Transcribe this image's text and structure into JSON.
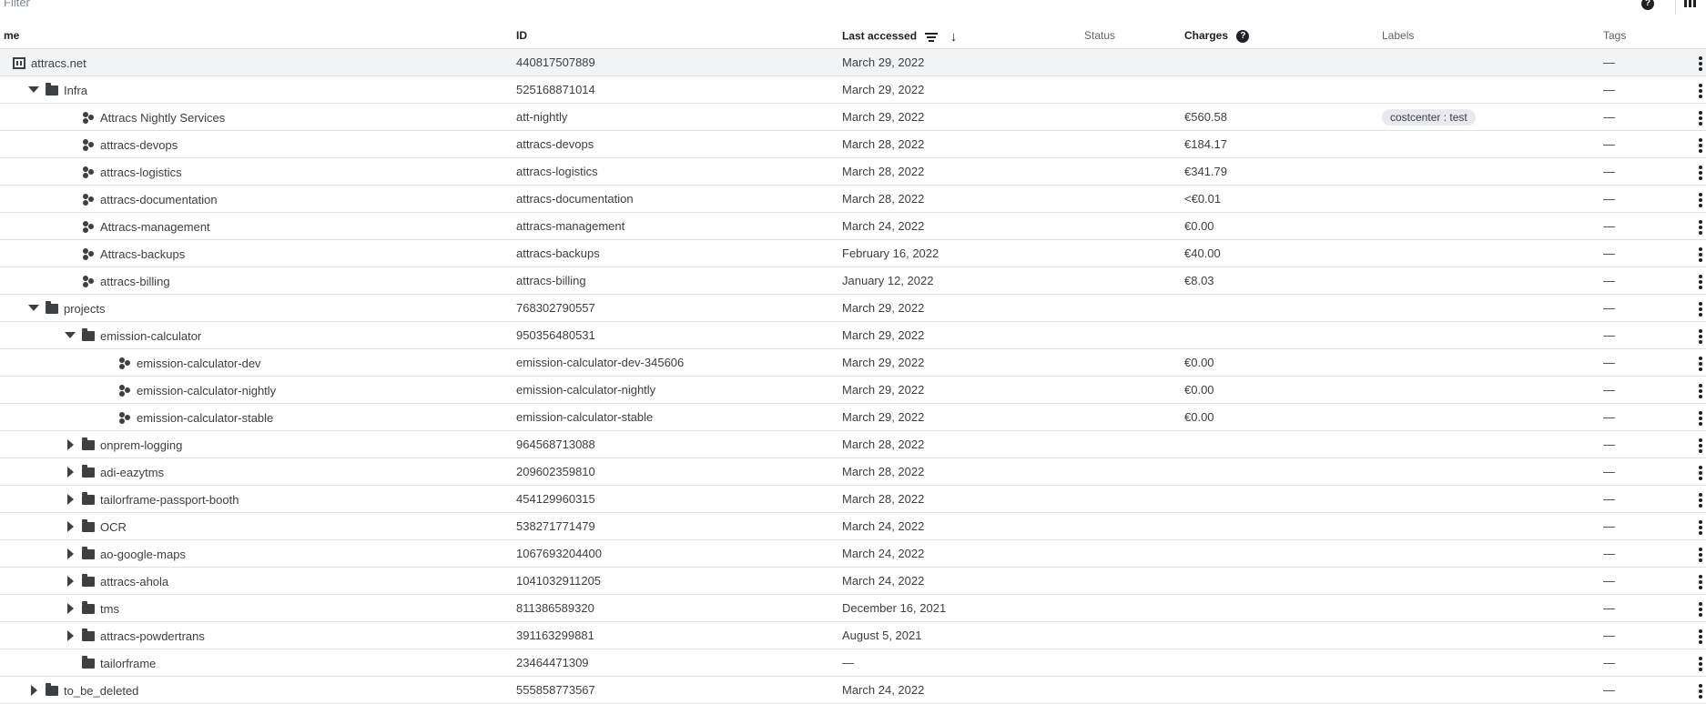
{
  "filter": {
    "placeholder": "Filter",
    "help_icon": "?"
  },
  "columns": {
    "name": "me",
    "id": "ID",
    "last_accessed": "Last accessed",
    "status": "Status",
    "charges": "Charges",
    "charges_help": "?",
    "labels": "Labels",
    "tags": "Tags",
    "sort_arrow": "↓"
  },
  "rows": [
    {
      "type": "org",
      "depth": 0,
      "toggle": "none",
      "name": "attracs.net",
      "id": "440817507889",
      "last": "March 29, 2022",
      "charges": "",
      "label": "",
      "tags": "—"
    },
    {
      "type": "folder",
      "depth": 1,
      "toggle": "down",
      "name": "Infra",
      "id": "525168871014",
      "last": "March 29, 2022",
      "charges": "",
      "label": "",
      "tags": "—"
    },
    {
      "type": "project",
      "depth": 2,
      "toggle": "none",
      "name": "Attracs Nightly Services",
      "id": "att-nightly",
      "last": "March 29, 2022",
      "charges": "€560.58",
      "label": "costcenter : test",
      "tags": "—"
    },
    {
      "type": "project",
      "depth": 2,
      "toggle": "none",
      "name": "attracs-devops",
      "id": "attracs-devops",
      "last": "March 28, 2022",
      "charges": "€184.17",
      "label": "",
      "tags": "—"
    },
    {
      "type": "project",
      "depth": 2,
      "toggle": "none",
      "name": "attracs-logistics",
      "id": "attracs-logistics",
      "last": "March 28, 2022",
      "charges": "€341.79",
      "label": "",
      "tags": "—"
    },
    {
      "type": "project",
      "depth": 2,
      "toggle": "none",
      "name": "attracs-documentation",
      "id": "attracs-documentation",
      "last": "March 28, 2022",
      "charges": "<€0.01",
      "label": "",
      "tags": "—"
    },
    {
      "type": "project",
      "depth": 2,
      "toggle": "none",
      "name": "Attracs-management",
      "id": "attracs-management",
      "last": "March 24, 2022",
      "charges": "€0.00",
      "label": "",
      "tags": "—"
    },
    {
      "type": "project",
      "depth": 2,
      "toggle": "none",
      "name": "Attracs-backups",
      "id": "attracs-backups",
      "last": "February 16, 2022",
      "charges": "€40.00",
      "label": "",
      "tags": "—"
    },
    {
      "type": "project",
      "depth": 2,
      "toggle": "none",
      "name": "attracs-billing",
      "id": "attracs-billing",
      "last": "January 12, 2022",
      "charges": "€8.03",
      "label": "",
      "tags": "—"
    },
    {
      "type": "folder",
      "depth": 1,
      "toggle": "down",
      "name": "projects",
      "id": "768302790557",
      "last": "March 29, 2022",
      "charges": "",
      "label": "",
      "tags": "—"
    },
    {
      "type": "folder",
      "depth": 2,
      "toggle": "down",
      "name": "emission-calculator",
      "id": "950356480531",
      "last": "March 29, 2022",
      "charges": "",
      "label": "",
      "tags": "—"
    },
    {
      "type": "project",
      "depth": 3,
      "toggle": "none",
      "name": "emission-calculator-dev",
      "id": "emission-calculator-dev-345606",
      "last": "March 29, 2022",
      "charges": "€0.00",
      "label": "",
      "tags": "—"
    },
    {
      "type": "project",
      "depth": 3,
      "toggle": "none",
      "name": "emission-calculator-nightly",
      "id": "emission-calculator-nightly",
      "last": "March 29, 2022",
      "charges": "€0.00",
      "label": "",
      "tags": "—"
    },
    {
      "type": "project",
      "depth": 3,
      "toggle": "none",
      "name": "emission-calculator-stable",
      "id": "emission-calculator-stable",
      "last": "March 29, 2022",
      "charges": "€0.00",
      "label": "",
      "tags": "—"
    },
    {
      "type": "folder",
      "depth": 2,
      "toggle": "right",
      "name": "onprem-logging",
      "id": "964568713088",
      "last": "March 28, 2022",
      "charges": "",
      "label": "",
      "tags": "—"
    },
    {
      "type": "folder",
      "depth": 2,
      "toggle": "right",
      "name": "adi-eazytms",
      "id": "209602359810",
      "last": "March 28, 2022",
      "charges": "",
      "label": "",
      "tags": "—"
    },
    {
      "type": "folder",
      "depth": 2,
      "toggle": "right",
      "name": "tailorframe-passport-booth",
      "id": "454129960315",
      "last": "March 28, 2022",
      "charges": "",
      "label": "",
      "tags": "—"
    },
    {
      "type": "folder",
      "depth": 2,
      "toggle": "right",
      "name": "OCR",
      "id": "538271771479",
      "last": "March 24, 2022",
      "charges": "",
      "label": "",
      "tags": "—"
    },
    {
      "type": "folder",
      "depth": 2,
      "toggle": "right",
      "name": "ao-google-maps",
      "id": "1067693204400",
      "last": "March 24, 2022",
      "charges": "",
      "label": "",
      "tags": "—"
    },
    {
      "type": "folder",
      "depth": 2,
      "toggle": "right",
      "name": "attracs-ahola",
      "id": "1041032911205",
      "last": "March 24, 2022",
      "charges": "",
      "label": "",
      "tags": "—"
    },
    {
      "type": "folder",
      "depth": 2,
      "toggle": "right",
      "name": "tms",
      "id": "811386589320",
      "last": "December 16, 2021",
      "charges": "",
      "label": "",
      "tags": "—"
    },
    {
      "type": "folder",
      "depth": 2,
      "toggle": "right",
      "name": "attracs-powdertrans",
      "id": "391163299881",
      "last": "August 5, 2021",
      "charges": "",
      "label": "",
      "tags": "—"
    },
    {
      "type": "folder",
      "depth": 2,
      "toggle": "none",
      "name": "tailorframe",
      "id": "23464471309",
      "last": "—",
      "charges": "",
      "label": "",
      "tags": "—"
    },
    {
      "type": "folder",
      "depth": 1,
      "toggle": "right",
      "name": "to_be_deleted",
      "id": "555858773567",
      "last": "March 24, 2022",
      "charges": "",
      "label": "",
      "tags": "—"
    }
  ]
}
